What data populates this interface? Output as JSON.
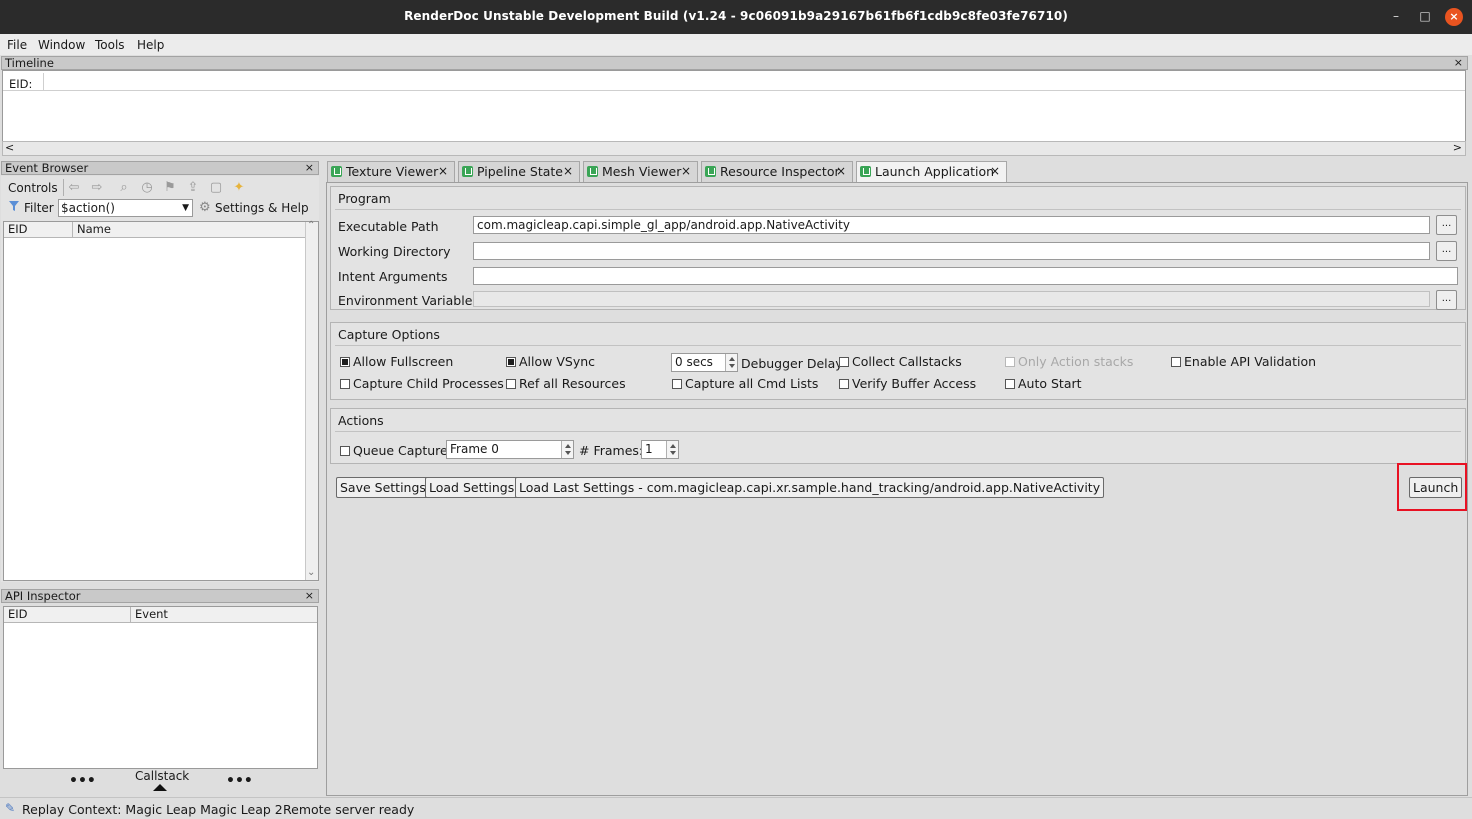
{
  "window": {
    "title": "RenderDoc Unstable Development Build (v1.24 - 9c06091b9a29167b61fb6f1cdb9c8fe03fe76710)",
    "minimize": "–",
    "maximize": "□",
    "close": "×"
  },
  "menu": {
    "file": "File",
    "window": "Window",
    "tools": "Tools",
    "help": "Help"
  },
  "timeline": {
    "title": "Timeline",
    "eid_label": "EID:",
    "close": "×",
    "scroll_left": "<",
    "scroll_right": ">"
  },
  "event_browser": {
    "title": "Event Browser",
    "close": "×",
    "controls_label": "Controls",
    "filter_label": "Filter",
    "filter_value": "$action()",
    "settings_help": "Settings & Help",
    "columns": [
      "EID",
      "Name"
    ]
  },
  "api_inspector": {
    "title": "API Inspector",
    "close": "×",
    "columns": [
      "EID",
      "Event"
    ],
    "callstack_label": "Callstack",
    "dots_left": "•••",
    "dots_right": "•••"
  },
  "tabs": [
    {
      "label": "Texture Viewer",
      "close": "×"
    },
    {
      "label": "Pipeline State",
      "close": "×"
    },
    {
      "label": "Mesh Viewer",
      "close": "×"
    },
    {
      "label": "Resource Inspector",
      "close": "×"
    },
    {
      "label": "Launch Application",
      "close": "×"
    }
  ],
  "program": {
    "title": "Program",
    "executable_path_label": "Executable Path",
    "executable_path_value": "com.magicleap.capi.simple_gl_app/android.app.NativeActivity",
    "working_directory_label": "Working Directory",
    "working_directory_value": "",
    "intent_arguments_label": "Intent Arguments",
    "intent_arguments_value": "",
    "environment_variables_label": "Environment Variables",
    "environment_variables_value": "",
    "browse": "..."
  },
  "capture_options": {
    "title": "Capture Options",
    "allow_fullscreen": "Allow Fullscreen",
    "allow_vsync": "Allow VSync",
    "debugger_delay_value": "0 secs",
    "debugger_delay_label": "Debugger Delay",
    "collect_callstacks": "Collect Callstacks",
    "only_action_stacks": "Only Action stacks",
    "enable_api_validation": "Enable API Validation",
    "capture_child_processes": "Capture Child Processes",
    "ref_all_resources": "Ref all Resources",
    "capture_all_cmd_lists": "Capture all Cmd Lists",
    "verify_buffer_access": "Verify Buffer Access",
    "auto_start": "Auto Start"
  },
  "actions": {
    "title": "Actions",
    "queue_capture": "Queue Capture",
    "frame_value": "Frame 0",
    "frames_label": "# Frames:",
    "frames_value": "1"
  },
  "buttons": {
    "save_settings": "Save Settings",
    "load_settings": "Load Settings",
    "load_last_settings": "Load Last Settings - com.magicleap.capi.xr.sample.hand_tracking/android.app.NativeActivity",
    "launch": "Launch"
  },
  "status": {
    "replay_context": "Replay Context: Magic Leap Magic Leap 2",
    "remote_server": "Remote server ready"
  },
  "colors": {
    "highlight": "#e81123",
    "tab_icon": "#3aa556",
    "titlebar": "#2b2b2b",
    "close_button": "#e95420"
  }
}
